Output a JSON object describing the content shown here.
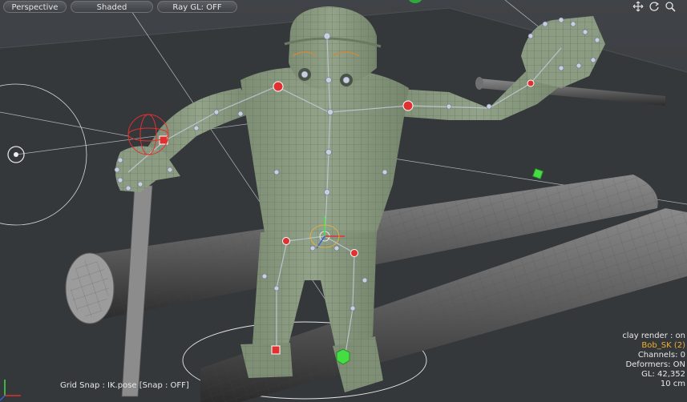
{
  "toolbar": {
    "view_mode": "Perspective",
    "shading": "Shaded",
    "raygl": "Ray GL: OFF"
  },
  "nav_icons": [
    "move-view-icon",
    "rotate-view-icon",
    "zoom-view-icon"
  ],
  "info": {
    "clay_render": "clay render : on",
    "item": "Bob_SK (2)",
    "channels": "Channels: 0",
    "deformers": "Deformers: ON",
    "gl": "GL: 42,352",
    "scale": "10 cm"
  },
  "status": {
    "snap": "Grid Snap : IK.pose  [Snap : OFF]"
  },
  "colors": {
    "mesh": "#8a9a80",
    "wire": "#5f6e58",
    "bone": "#b9c3cc",
    "joint": "#c8d0e0",
    "ik_handle": "#e03030",
    "locator": "#44dd44",
    "accent": "#f0b030"
  }
}
